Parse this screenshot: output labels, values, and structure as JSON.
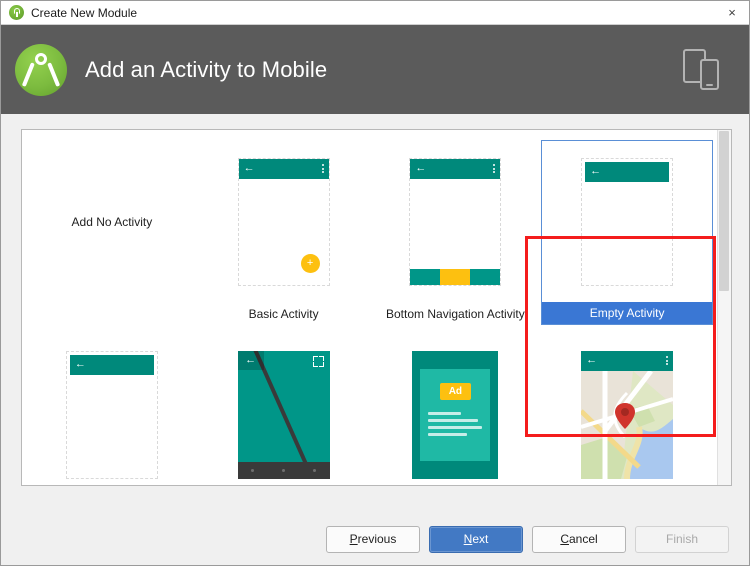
{
  "window": {
    "title": "Create New Module",
    "icon": "android-studio-icon",
    "close_label": "×"
  },
  "header": {
    "title": "Add an Activity to Mobile",
    "logo": "android-studio-logo",
    "devices_icon": "tablet-and-phone-icon"
  },
  "gallery": {
    "templates": [
      {
        "label": "Add No Activity",
        "kind": "text",
        "selected": false,
        "appbar": {
          "back": "←",
          "overflow": false
        }
      },
      {
        "label": "Basic Activity",
        "kind": "phone",
        "selected": false,
        "appbar": {
          "back": "←",
          "overflow": true
        },
        "fab": {
          "glyph": "+",
          "color": "#fdc010"
        }
      },
      {
        "label": "Bottom Navigation Activity",
        "kind": "phone-bottomnav",
        "selected": false,
        "appbar": {
          "back": "←",
          "overflow": true
        },
        "bottom_nav_colors": [
          "#009688",
          "#fdc010",
          "#009688"
        ]
      },
      {
        "label": "Empty Activity",
        "kind": "phone",
        "selected": true,
        "appbar": {
          "back": "←",
          "overflow": false
        }
      },
      {
        "label": "",
        "kind": "phone",
        "selected": false,
        "appbar": {
          "back": "←",
          "overflow": false
        }
      },
      {
        "label": "",
        "kind": "fullscreen",
        "selected": false,
        "appbar": {
          "back": "←",
          "overflow": false
        },
        "fullscreen_icon": "expand-icon"
      },
      {
        "label": "",
        "kind": "ad",
        "selected": false,
        "ad_badge": "Ad"
      },
      {
        "label": "",
        "kind": "map",
        "selected": false,
        "appbar": {
          "back": "←",
          "overflow": true
        },
        "pin": "map-pin-icon"
      }
    ]
  },
  "scrollbar": {
    "orientation": "vertical",
    "thumb_position_percent": 0
  },
  "annotation": {
    "color": "#f41c1c",
    "target": "Empty Activity"
  },
  "footer": {
    "buttons": [
      {
        "label": "Previous",
        "mnemonic": "P",
        "state": "enabled",
        "default": false
      },
      {
        "label": "Next",
        "mnemonic": "N",
        "state": "enabled",
        "default": true
      },
      {
        "label": "Cancel",
        "mnemonic": "C",
        "state": "enabled",
        "default": false
      },
      {
        "label": "Finish",
        "mnemonic": "",
        "state": "disabled",
        "default": false
      }
    ]
  },
  "colors": {
    "header_bg": "#5b5b5b",
    "teal": "#009688",
    "amber": "#fdc010",
    "selection_blue": "#3a77d4",
    "default_button_blue": "#4279c4",
    "annotation_red": "#f41c1c"
  }
}
